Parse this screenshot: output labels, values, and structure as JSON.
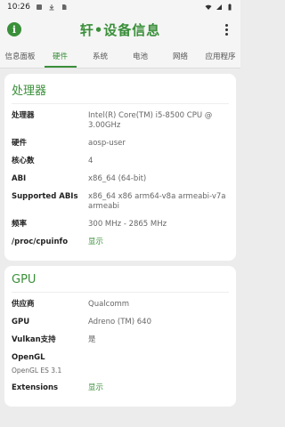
{
  "status": {
    "time": "10:26"
  },
  "app": {
    "title": "轩•设备信息"
  },
  "tabs": [
    "信息面板",
    "硬件",
    "系统",
    "电池",
    "网络",
    "应用程序"
  ],
  "processor": {
    "title": "处理器",
    "rows": [
      {
        "k": "处理器",
        "v": "Intel(R) Core(TM) i5-8500 CPU @ 3.00GHz"
      },
      {
        "k": "硬件",
        "v": "aosp-user"
      },
      {
        "k": "核心数",
        "v": "4"
      },
      {
        "k": "ABI",
        "v": "x86_64 (64-bit)"
      },
      {
        "k": "Supported ABIs",
        "v": "x86_64 x86 arm64-v8a armeabi-v7a armeabi"
      },
      {
        "k": "频率",
        "v": "300 MHz - 2865 MHz"
      },
      {
        "k": "/proc/cpuinfo",
        "v": "显示"
      }
    ]
  },
  "gpu": {
    "title": "GPU",
    "rows": [
      {
        "k": "供应商",
        "v": "Qualcomm"
      },
      {
        "k": "GPU",
        "v": "Adreno (TM) 640"
      },
      {
        "k": "Vulkan支持",
        "v": "是"
      },
      {
        "k": "OpenGL",
        "v": "OpenGL ES 3.1"
      },
      {
        "k": "Extensions",
        "v": "显示"
      }
    ]
  }
}
